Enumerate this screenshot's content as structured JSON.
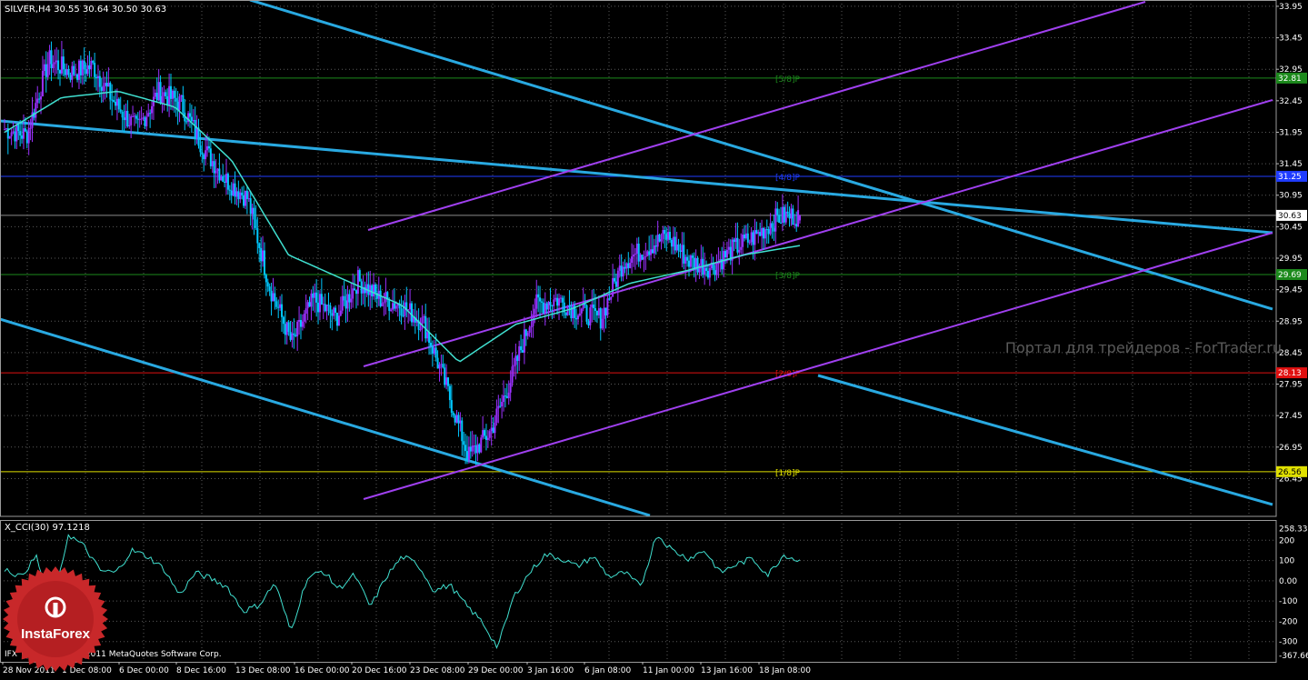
{
  "header": {
    "symbol_label": "SILVER,H4 30.55 30.64 30.50 30.63"
  },
  "watermark": "Портал для трейдеров - ForTrader.ru",
  "indicator": {
    "label": "X_CCI(30) 97.1218"
  },
  "copyright": "IFX Trader, © 2001-2011 MetaQuotes Software Corp.",
  "badge": {
    "brand": "InstaForex"
  },
  "colors": {
    "background": "#000000",
    "grid": "#5a5a5a",
    "bull_candle": "#9b30ff",
    "bear_candle": "#00c8ff",
    "moving_average": "#40e0d0",
    "channel_down": "#29a9e1",
    "channel_up": "#a040f0",
    "cci_line": "#40e0d0",
    "badge_red": "#c8282a"
  },
  "chart_data": [
    {
      "type": "candlestick",
      "title": "SILVER,H4",
      "ohlc_last": {
        "open": 30.55,
        "high": 30.64,
        "low": 30.5,
        "close": 30.63
      },
      "ylim": [
        25.85,
        34.05
      ],
      "y_ticks": [
        "33.95",
        "33.45",
        "32.95",
        "32.45",
        "31.95",
        "31.45",
        "30.95",
        "30.45",
        "29.95",
        "29.45",
        "28.95",
        "28.45",
        "27.95",
        "27.45",
        "26.95",
        "26.45"
      ],
      "x_ticks": [
        "28 Nov 2011",
        "1 Dec 08:00",
        "6 Dec 00:00",
        "8 Dec 16:00",
        "13 Dec 08:00",
        "16 Dec 00:00",
        "20 Dec 16:00",
        "23 Dec 08:00",
        "29 Dec 00:00",
        "3 Jan 16:00",
        "6 Jan 08:00",
        "11 Jan 00:00",
        "13 Jan 16:00",
        "18 Jan 08:00"
      ],
      "current_price": {
        "value": 30.63,
        "label": "30.63"
      },
      "levels": [
        {
          "name": "[5/8]P",
          "price": 32.81,
          "label": "32.81",
          "color": "#1c8a1c"
        },
        {
          "name": "[4/8]P",
          "price": 31.25,
          "label": "31.25",
          "color": "#1f3cff"
        },
        {
          "name": "[3/8]P",
          "price": 29.69,
          "label": "29.69",
          "color": "#1c8a1c"
        },
        {
          "name": "[2/8]P",
          "price": 28.13,
          "label": "28.13",
          "color": "#e01010"
        },
        {
          "name": "[1/8]P",
          "price": 26.56,
          "label": "26.56",
          "color": "#e0e000"
        }
      ],
      "close_path": [
        {
          "x": "28 Nov 2011",
          "y": 32.0
        },
        {
          "x": "29 Nov",
          "y": 31.9
        },
        {
          "x": "30 Nov",
          "y": 33.1
        },
        {
          "x": "1 Dec 08:00",
          "y": 32.9
        },
        {
          "x": "2 Dec",
          "y": 33.0
        },
        {
          "x": "5 Dec",
          "y": 32.4
        },
        {
          "x": "6 Dec 00:00",
          "y": 32.0
        },
        {
          "x": "7 Dec",
          "y": 32.6
        },
        {
          "x": "8 Dec 16:00",
          "y": 32.4
        },
        {
          "x": "9 Dec",
          "y": 31.7
        },
        {
          "x": "12 Dec",
          "y": 31.2
        },
        {
          "x": "13 Dec 08:00",
          "y": 30.9
        },
        {
          "x": "14 Dec",
          "y": 29.5
        },
        {
          "x": "15 Dec",
          "y": 28.6
        },
        {
          "x": "16 Dec 00:00",
          "y": 29.3
        },
        {
          "x": "19 Dec",
          "y": 29.0
        },
        {
          "x": "20 Dec 16:00",
          "y": 29.6
        },
        {
          "x": "21 Dec",
          "y": 29.3
        },
        {
          "x": "22 Dec",
          "y": 29.2
        },
        {
          "x": "23 Dec 08:00",
          "y": 28.9
        },
        {
          "x": "27 Dec",
          "y": 27.9
        },
        {
          "x": "28 Dec",
          "y": 26.8
        },
        {
          "x": "29 Dec 00:00",
          "y": 27.2
        },
        {
          "x": "30 Dec",
          "y": 28.1
        },
        {
          "x": "3 Jan 16:00",
          "y": 29.2
        },
        {
          "x": "4 Jan",
          "y": 29.3
        },
        {
          "x": "5 Jan",
          "y": 29.1
        },
        {
          "x": "6 Jan 08:00",
          "y": 29.0
        },
        {
          "x": "9 Jan",
          "y": 29.9
        },
        {
          "x": "10 Jan",
          "y": 30.1
        },
        {
          "x": "11 Jan 00:00",
          "y": 30.3
        },
        {
          "x": "12 Jan",
          "y": 29.9
        },
        {
          "x": "13 Jan 16:00",
          "y": 29.8
        },
        {
          "x": "16 Jan",
          "y": 30.1
        },
        {
          "x": "17 Jan",
          "y": 30.3
        },
        {
          "x": "18 Jan 08:00",
          "y": 30.6
        },
        {
          "x": "19 Jan",
          "y": 30.63
        }
      ],
      "moving_average": [
        {
          "x": "28 Nov 2011",
          "y": 31.95
        },
        {
          "x": "1 Dec 08:00",
          "y": 32.5
        },
        {
          "x": "6 Dec 00:00",
          "y": 32.6
        },
        {
          "x": "8 Dec 16:00",
          "y": 32.35
        },
        {
          "x": "13 Dec 08:00",
          "y": 31.5
        },
        {
          "x": "16 Dec 00:00",
          "y": 30.0
        },
        {
          "x": "20 Dec 16:00",
          "y": 29.6
        },
        {
          "x": "23 Dec 08:00",
          "y": 29.2
        },
        {
          "x": "29 Dec 00:00",
          "y": 28.3
        },
        {
          "x": "3 Jan 16:00",
          "y": 28.9
        },
        {
          "x": "6 Jan 08:00",
          "y": 29.15
        },
        {
          "x": "11 Jan 00:00",
          "y": 29.55
        },
        {
          "x": "13 Jan 16:00",
          "y": 29.75
        },
        {
          "x": "18 Jan 08:00",
          "y": 30.0
        },
        {
          "x": "19 Jan",
          "y": 30.15
        }
      ]
    },
    {
      "type": "line",
      "title": "X_CCI(30) 97.1218",
      "ylim": [
        -400,
        300
      ],
      "y_ticks": [
        "258.3316",
        "200",
        "100",
        "0.00",
        "-100",
        "-200",
        "-300",
        "-367.666"
      ],
      "series": [
        {
          "name": "X_CCI(30)",
          "values": [
            60,
            20,
            120,
            -150,
            230,
            170,
            50,
            40,
            150,
            120,
            60,
            -70,
            40,
            10,
            -30,
            -150,
            -120,
            -10,
            -250,
            10,
            50,
            -40,
            30,
            -130,
            20,
            120,
            80,
            -50,
            -20,
            -120,
            -200,
            -330,
            -80,
            40,
            130,
            110,
            70,
            120,
            20,
            40,
            -30,
            230,
            150,
            110,
            150,
            40,
            80,
            110,
            30,
            130,
            97
          ]
        }
      ]
    }
  ]
}
